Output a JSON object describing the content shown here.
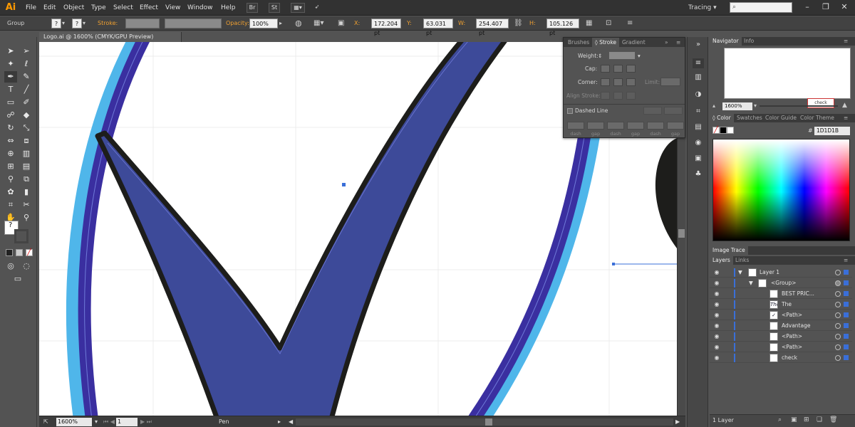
{
  "app": {
    "logo": "Ai"
  },
  "menu": [
    "File",
    "Edit",
    "Object",
    "Type",
    "Select",
    "Effect",
    "View",
    "Window",
    "Help"
  ],
  "menubar_buttons": {
    "br": "Br",
    "st": "St"
  },
  "workspace": "Tracing",
  "control_bar": {
    "selection": "Group",
    "stroke_label": "Stroke:",
    "opacity_label": "Opacity:",
    "opacity_value": "100%",
    "x_label": "X:",
    "x_value": "172.204 pt",
    "y_label": "Y:",
    "y_value": "63.031 pt",
    "w_label": "W:",
    "w_value": "254.407 pt",
    "h_label": "H:",
    "h_value": "105.126 pt",
    "unknown_glyph": "?"
  },
  "document": {
    "tab_title": "Logo.ai @ 1600% (CMYK/GPU Preview)"
  },
  "status_bar": {
    "zoom": "1600%",
    "artboard": "1",
    "tool": "Pen"
  },
  "stroke_panel": {
    "tabs": [
      "Brushes",
      "Stroke",
      "Gradient"
    ],
    "active_tab": "Stroke",
    "weight_label": "Weight:",
    "cap_label": "Cap:",
    "corner_label": "Corner:",
    "limit_label": "Limit:",
    "align_label": "Align Stroke:",
    "dashed_label": "Dashed Line",
    "dash_labels": [
      "dash",
      "gap",
      "dash",
      "gap",
      "dash",
      "gap"
    ]
  },
  "navigator": {
    "tabs": [
      "Navigator",
      "Info"
    ],
    "zoom": "1600%",
    "thumb_text": "check"
  },
  "color_panel": {
    "tabs": [
      "Color",
      "Swatches",
      "Color Guide",
      "Color Theme"
    ],
    "hex_prefix": "#",
    "hex": "1D1D1B"
  },
  "image_trace": {
    "title": "Image Trace"
  },
  "layers_panel": {
    "tabs": [
      "Layers",
      "Links"
    ],
    "rows": [
      {
        "name": "Layer 1",
        "thumb": ""
      },
      {
        "name": "<Group>",
        "thumb": ""
      },
      {
        "name": "BEST PRIC...",
        "thumb": ""
      },
      {
        "name": "The",
        "thumb": "The"
      },
      {
        "name": "<Path>",
        "thumb": "✓"
      },
      {
        "name": "Advantage",
        "thumb": ""
      },
      {
        "name": "<Path>",
        "thumb": ""
      },
      {
        "name": "<Path>",
        "thumb": ""
      },
      {
        "name": "check",
        "thumb": ""
      }
    ],
    "footer": "1 Layer"
  },
  "colors": {
    "check_fill": "#3d4a99",
    "ring_dark": "#3a2fa0",
    "ring_light": "#4fb6ea",
    "outline": "#1d1d1b",
    "accent_orange": "#f0a030",
    "selection_blue": "#3a6fd8"
  },
  "icons": {
    "tools": [
      "selection-icon",
      "direct-selection-icon",
      "magic-wand-icon",
      "lasso-icon",
      "pen-icon",
      "curvature-icon",
      "type-icon",
      "line-icon",
      "rectangle-icon",
      "paintbrush-icon",
      "shaper-icon",
      "eraser-icon",
      "rotate-icon",
      "scale-icon",
      "width-icon",
      "free-transform-icon",
      "shape-builder-icon",
      "perspective-icon",
      "mesh-icon",
      "gradient-icon",
      "eyedropper-icon",
      "blend-icon",
      "symbol-sprayer-icon",
      "graph-icon",
      "artboard-icon",
      "slice-icon",
      "hand-icon",
      "zoom-icon"
    ]
  }
}
